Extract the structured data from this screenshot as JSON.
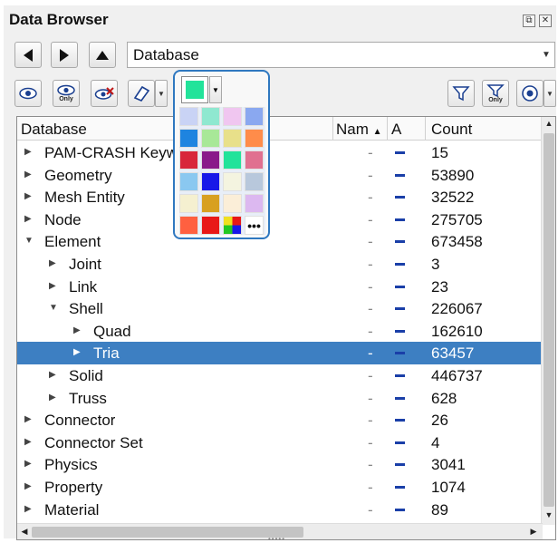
{
  "panel": {
    "title": "Data Browser"
  },
  "database_combo": {
    "value": "Database"
  },
  "tree": {
    "headers": {
      "name": "Database",
      "nam": "Nam",
      "a": "A",
      "count": "Count"
    },
    "rows": [
      {
        "label": "PAM-CRASH Keywords",
        "nam": "-",
        "count": "15",
        "level": 0,
        "expanded": false,
        "selected": false
      },
      {
        "label": "Geometry",
        "nam": "-",
        "count": "53890",
        "level": 0,
        "expanded": false,
        "selected": false
      },
      {
        "label": "Mesh Entity",
        "nam": "-",
        "count": "32522",
        "level": 0,
        "expanded": false,
        "selected": false
      },
      {
        "label": "Node",
        "nam": "-",
        "count": "275705",
        "level": 0,
        "expanded": false,
        "selected": false
      },
      {
        "label": "Element",
        "nam": "-",
        "count": "673458",
        "level": 0,
        "expanded": true,
        "selected": false
      },
      {
        "label": "Joint",
        "nam": "-",
        "count": "3",
        "level": 1,
        "expanded": false,
        "selected": false
      },
      {
        "label": "Link",
        "nam": "-",
        "count": "23",
        "level": 1,
        "expanded": false,
        "selected": false
      },
      {
        "label": "Shell",
        "nam": "-",
        "count": "226067",
        "level": 1,
        "expanded": true,
        "selected": false
      },
      {
        "label": "Quad",
        "nam": "-",
        "count": "162610",
        "level": 2,
        "expanded": false,
        "selected": false
      },
      {
        "label": "Tria",
        "nam": "-",
        "count": "63457",
        "level": 2,
        "expanded": false,
        "selected": true
      },
      {
        "label": "Solid",
        "nam": "-",
        "count": "446737",
        "level": 1,
        "expanded": false,
        "selected": false
      },
      {
        "label": "Truss",
        "nam": "-",
        "count": "628",
        "level": 1,
        "expanded": false,
        "selected": false
      },
      {
        "label": "Connector",
        "nam": "-",
        "count": "26",
        "level": 0,
        "expanded": false,
        "selected": false
      },
      {
        "label": "Connector Set",
        "nam": "-",
        "count": "4",
        "level": 0,
        "expanded": false,
        "selected": false
      },
      {
        "label": "Physics",
        "nam": "-",
        "count": "3041",
        "level": 0,
        "expanded": false,
        "selected": false
      },
      {
        "label": "Property",
        "nam": "-",
        "count": "1074",
        "level": 0,
        "expanded": false,
        "selected": false
      },
      {
        "label": "Material",
        "nam": "-",
        "count": "89",
        "level": 0,
        "expanded": false,
        "selected": false
      }
    ]
  },
  "toolbar": {
    "only_label": "Only",
    "current_color": "#22e39a"
  },
  "palette": {
    "colors": [
      "#c9d3f5",
      "#8fe8d0",
      "#f0c6f0",
      "#8aa8f0",
      "#1e84e0",
      "#a8e898",
      "#e8e08a",
      "#ff8c4a",
      "#d8263a",
      "#8a1a8a",
      "#22e39a",
      "#e07090",
      "#8ac8f0",
      "#1818e8",
      "#f4f4e0",
      "#b8c8dc",
      "#f5f0d0",
      "#d8a020",
      "#fbeed8",
      "#dcb8f0",
      "#ff6040",
      "#e81818",
      "multi",
      "more"
    ],
    "more_label": "•••"
  },
  "icons": {
    "back": "back-arrow-icon",
    "forward": "forward-arrow-icon",
    "up": "up-arrow-icon",
    "show": "eye-icon",
    "show_only": "eye-only-icon",
    "hide": "eye-hide-icon",
    "eraser": "eraser-icon",
    "filter": "filter-icon",
    "filter_only": "filter-only-icon",
    "target": "target-icon",
    "float": "float-window-icon",
    "close": "close-icon"
  }
}
